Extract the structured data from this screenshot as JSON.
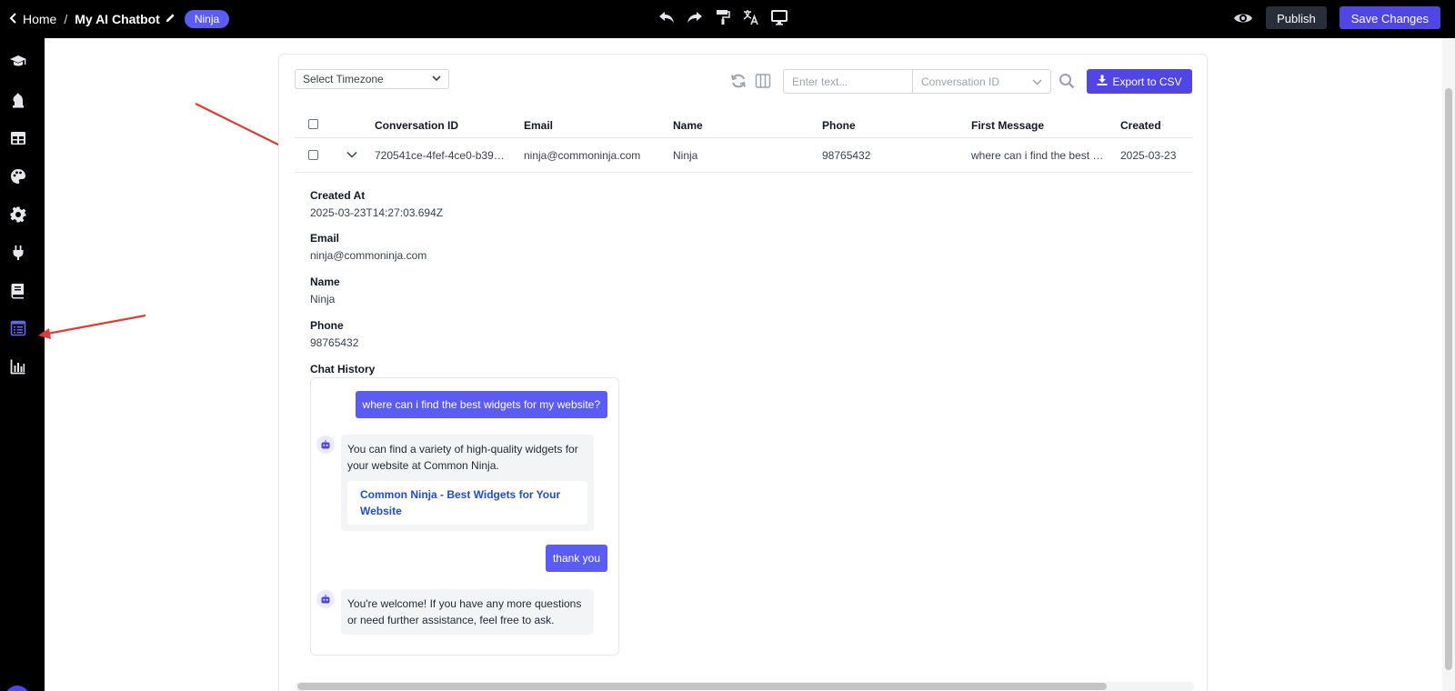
{
  "topbar": {
    "home_label": "Home",
    "separator": "/",
    "title": "My AI Chatbot",
    "badge": "Ninja",
    "publish_label": "Publish",
    "save_label": "Save Changes",
    "center_icons": [
      "undo-icon",
      "redo-icon",
      "paint-roller-icon",
      "translate-icon",
      "desktop-icon"
    ]
  },
  "sidebar": {
    "items": [
      {
        "icon": "graduation-cap-icon",
        "active": false
      },
      {
        "icon": "chess-knight-icon",
        "active": false
      },
      {
        "icon": "table-icon",
        "active": false
      },
      {
        "icon": "palette-icon",
        "active": false
      },
      {
        "icon": "gear-icon",
        "active": false
      },
      {
        "icon": "plug-icon",
        "active": false
      },
      {
        "icon": "book-icon",
        "active": false
      },
      {
        "icon": "list-icon",
        "active": true
      },
      {
        "icon": "bar-chart-icon",
        "active": false
      }
    ],
    "active_color": "#6366f1"
  },
  "toolbar": {
    "timezone_placeholder": "Select Timezone",
    "search_placeholder": "Enter text...",
    "search_field_select": "Conversation ID",
    "export_label": "Export to CSV"
  },
  "table": {
    "headers": [
      "Conversation ID",
      "Email",
      "Name",
      "Phone",
      "First Message",
      "Created"
    ],
    "rows": [
      {
        "conversation_id": "720541ce-4fef-4ce0-b39…",
        "email": "ninja@commoninja.com",
        "name": "Ninja",
        "phone": "98765432",
        "first_message": "where can i find the best …",
        "created": "2025-03-23"
      }
    ]
  },
  "details": {
    "created_at_label": "Created At",
    "created_at_value": "2025-03-23T14:27:03.694Z",
    "email_label": "Email",
    "email_value": "ninja@commoninja.com",
    "name_label": "Name",
    "name_value": "Ninja",
    "phone_label": "Phone",
    "phone_value": "98765432",
    "chat_history_label": "Chat History"
  },
  "chat": {
    "user_msg_1": "where can i find the best widgets for my website?",
    "bot_msg_1_line1": "You can find a variety of high-quality widgets for",
    "bot_msg_1_line2": "your website at Common Ninja.",
    "bot_link_line1": "Common Ninja - Best Widgets for Your",
    "bot_link_line2": "Website",
    "user_msg_2": "thank you",
    "bot_msg_2_line1": "You're welcome! If you have any more questions",
    "bot_msg_2_line2": "or need further assistance, feel free to ask."
  },
  "colors": {
    "primary": "#4f46e5",
    "user_bubble": "#5b5bf6",
    "annotation_arrow": "#e53935"
  }
}
